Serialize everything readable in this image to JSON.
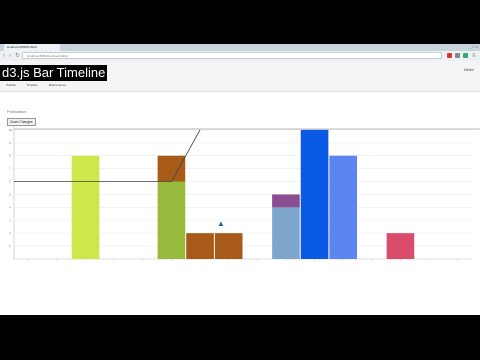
{
  "browser": {
    "tab_title": "localhost:8080/Publish",
    "url": "localhost:8080/timeline/publish",
    "window_controls": "_ □ ×"
  },
  "app": {
    "title": "d3.js Bar Timeline",
    "user": "Hello!",
    "nav": [
      "Publish",
      "Timeline",
      "Maintenance"
    ],
    "section_label": "Publication",
    "zoom_button": "Zoom Changes"
  },
  "chart_data": {
    "type": "bar",
    "y_ticks": [
      1,
      2,
      3,
      4,
      5,
      6,
      7,
      8,
      9,
      10
    ],
    "ylim": [
      0,
      10.3
    ],
    "slot_count": 16,
    "grid": "horizontal",
    "bars": [
      {
        "slot": 2,
        "segments": [
          {
            "value": 8,
            "color": "#cce84a"
          }
        ]
      },
      {
        "slot": 5,
        "segments": [
          {
            "value": 6,
            "color": "#97b93c"
          },
          {
            "value": 2,
            "color": "#a85a18"
          }
        ]
      },
      {
        "slot": 6,
        "segments": [
          {
            "value": 2,
            "color": "#a85a18"
          }
        ]
      },
      {
        "slot": 7,
        "segments": [
          {
            "value": 2,
            "color": "#a85a18"
          }
        ]
      },
      {
        "slot": 9,
        "segments": [
          {
            "value": 4,
            "color": "#7ea6cc"
          },
          {
            "value": 1,
            "color": "#8a4f90"
          }
        ]
      },
      {
        "slot": 10,
        "segments": [
          {
            "value": 10,
            "color": "#0a5ae6"
          }
        ]
      },
      {
        "slot": 11,
        "segments": [
          {
            "value": 8,
            "color": "#5b86f2"
          }
        ]
      },
      {
        "slot": 13,
        "segments": [
          {
            "value": 2,
            "color": "#d94d6b"
          }
        ]
      }
    ],
    "line": {
      "color": "#444444",
      "points": [
        [
          0,
          6
        ],
        [
          5.5,
          6
        ],
        [
          6.5,
          10
        ]
      ]
    }
  }
}
